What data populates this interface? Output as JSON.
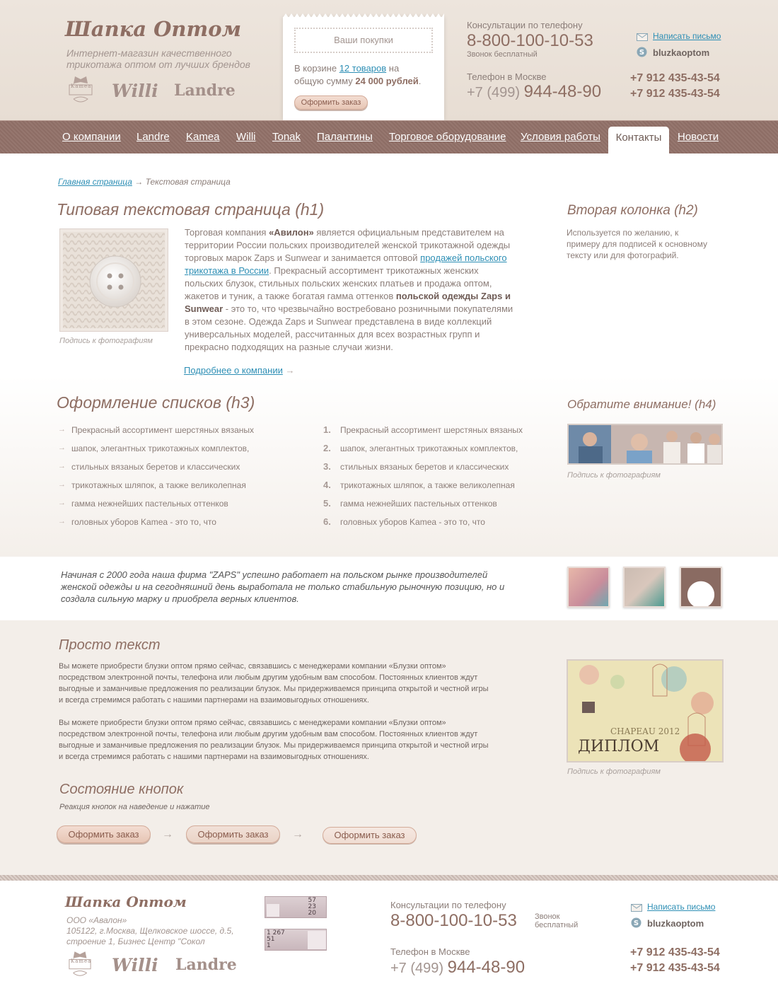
{
  "header": {
    "logo": "Шапка Оптом",
    "tagline_1": "Интернет-магазин качественного",
    "tagline_2": "трикотажа оптом от лучших брендов",
    "brands": [
      "Kamea",
      "Willi",
      "Landre"
    ],
    "cart": {
      "title": "Ваши покупки",
      "text_1": "В корзине",
      "count_link": "12 товаров",
      "text_2": "на",
      "text_3": "общую сумму",
      "sum": "24 000 рублей",
      "button": "Оформить заказ"
    },
    "consult_label": "Консультации по телефону",
    "consult_phone": "8-800-100-10-53",
    "free_call": "Звонок бесплатный",
    "moscow_label": "Телефон в Москве",
    "moscow_code": "+7 (499)",
    "moscow_number": "944-48-90",
    "write_link": "Написать письмо",
    "skype": "bluzkaoptom",
    "mobile_1": "+7 912 435-43-54",
    "mobile_2": "+7 912 435-43-54"
  },
  "nav": {
    "items": [
      "О компании",
      "Landre",
      "Kamea",
      "Willi",
      "Tonak",
      "Палантины",
      "Торговое оборудование",
      "Условия работы"
    ],
    "active": "Контакты",
    "last": "Новости"
  },
  "breadcrumb": {
    "home": "Главная страница",
    "arrow": "→",
    "current": "Текстовая страница"
  },
  "main": {
    "h1": "Типовая текстовая страница (h1)",
    "caption": "Подпись к фотографиям",
    "para_lines": [
      [
        "Торговая компания ",
        {
          "b": "«Авилон»"
        },
        " является официальным представителем на"
      ],
      [
        "территории России польских производителей женской трикотажной одежды"
      ],
      [
        "торговых марок Zaps и Sunwear и занимается оптовой ",
        {
          "a": "продажей польского"
        }
      ],
      [
        {
          "a": "трикотажа в России"
        },
        ". Прекрасный ассортимент трикотажных женских"
      ],
      [
        "польских блузок, стильных польских женских платьев и продажа оптом,"
      ],
      [
        "жакетов и туник, а также богатая гамма оттенков ",
        {
          "b": "польской одежды Zaps и"
        }
      ],
      [
        {
          "b": "Sunwear"
        },
        " - это то, что чрезвычайно востребовано розничными покупателями"
      ],
      [
        "в этом сезоне. Одежда Zaps и Sunwear представлена в виде коллекций"
      ],
      [
        "универсальных моделей, рассчитанных для всех возрастных групп и"
      ],
      [
        "прекрасно подходящих на разные случаи жизни."
      ]
    ],
    "more_link": "Подробнее о компании",
    "more_arrow": "→",
    "h3": "Оформление списков (h3)",
    "list": [
      "Прекрасный ассортимент шерстяных вязаных",
      "шапок, элегантных трикотажных комплектов,",
      "стильных вязаных беретов и классических",
      "трикотажных шляпок, а также великолепная",
      "гамма нежнейших пастельных оттенков",
      "головных уборов Kamea - это то, что"
    ],
    "list_numbers": [
      "1.",
      "2.",
      "3.",
      "4.",
      "5.",
      "6."
    ],
    "bullet": "→"
  },
  "sidebar": {
    "h2": "Вторая колонка (h2)",
    "text_lines": [
      "Используется по желанию, к",
      "примеру для подписей к основному",
      "тексту или для фотографий."
    ],
    "h4": "Обратите внимание! (h4)",
    "caption": "Подпись к фотографиям"
  },
  "quote": {
    "lines": [
      "Начиная с 2000 года наша фирма \"ZAPS\" успешно работает на польском рынке производителей",
      "женской одежды и на сегодняшний день выработала не только стабильную рыночную позицию, но и",
      "создала сильную марку и приобрела верных клиентов."
    ]
  },
  "plain": {
    "title": "Просто текст",
    "para1": [
      "Вы можете приобрести блузки оптом прямо сейчас, связавшись с менеджерами компании «Блузки оптом»",
      "посредством электронной почты, телефона или любым другим удобным вам способом. Постоянных клиентов ждут",
      "выгодные и заманчивые предложения по реализации блузок. Мы придерживаемся принципа открытой и честной игры",
      "и всегда стремимся работать с нашими партнерами на взаимовыгодных отношениях."
    ],
    "para2": [
      "Вы можете приобрести блузки оптом прямо сейчас, связавшись с менеджерами компании «Блузки оптом»",
      "посредством электронной почты, телефона или любым другим удобным вам способом. Постоянных клиентов ждут",
      "выгодные и заманчивые предложения по реализации блузок. Мы придерживаемся принципа открытой и честной игры",
      "и всегда стремимся работать с нашими партнерами на взаимовыгодных отношениях."
    ],
    "image_caption": "Подпись к фотографиям",
    "diploma_line1": "CHAPEAU 2012",
    "diploma_line2": "ДИПЛОМ",
    "buttons_title": "Состояние кнопок",
    "buttons_subtitle": "Реакция кнопок на наведение и нажатие",
    "button_label": "Оформить заказ",
    "arrow": "→"
  },
  "footer": {
    "logo": "Шапка Оптом",
    "company": "ООО «Авалон»",
    "address_1": "105122, г.Москва, Щелковское шоссе, д.5,",
    "address_2": "строение 1, Бизнес Центр \"Сокол",
    "brands": [
      "Kamea",
      "Willi",
      "Landre"
    ],
    "counter1": [
      "57",
      "23",
      "20"
    ],
    "counter2": [
      "1 267",
      "51",
      "1"
    ],
    "consult_label": "Консультации по телефону",
    "consult_phone": "8-800-100-10-53",
    "free_1": "Звонок",
    "free_2": "бесплатный",
    "moscow_label": "Телефон в Москве",
    "moscow_code": "+7 (499)",
    "moscow_number": "944-48-90",
    "write_link": "Написать письмо",
    "skype": "bluzkaoptom",
    "mobile_1": "+7 912 435-43-54",
    "mobile_2": "+7 912 435-43-54"
  },
  "colors": {
    "accent": "#8e6e63",
    "link": "#2e8fb5",
    "nav_bg": "#8d6d65",
    "button": "#e7c6b5"
  }
}
